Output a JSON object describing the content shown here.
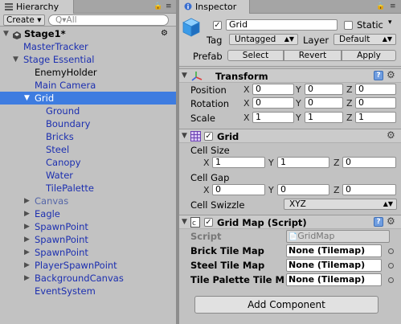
{
  "hierarchy": {
    "tab_label": "Hierarchy",
    "create_label": "Create",
    "search_placeholder": "Q▾All",
    "scene_name": "Stage1*",
    "items": [
      {
        "label": "MasterTracker",
        "color": "blue"
      },
      {
        "label": "Stage Essential",
        "color": "blue",
        "expanded": true
      },
      {
        "label": "EnemyHolder",
        "color": "black"
      },
      {
        "label": "Main Camera",
        "color": "blue"
      },
      {
        "label": "Grid",
        "color": "white",
        "selected": true,
        "expanded": true
      },
      {
        "label": "Ground",
        "color": "blue"
      },
      {
        "label": "Boundary",
        "color": "blue"
      },
      {
        "label": "Bricks",
        "color": "blue"
      },
      {
        "label": "Steel",
        "color": "blue"
      },
      {
        "label": "Canopy",
        "color": "blue"
      },
      {
        "label": "Water",
        "color": "blue"
      },
      {
        "label": "TilePalette",
        "color": "blue"
      },
      {
        "label": "Canvas",
        "color": "grey",
        "collapsed": true
      },
      {
        "label": "Eagle",
        "color": "blue",
        "collapsed": true
      },
      {
        "label": "SpawnPoint",
        "color": "blue",
        "collapsed": true
      },
      {
        "label": "SpawnPoint",
        "color": "blue",
        "collapsed": true
      },
      {
        "label": "SpawnPoint",
        "color": "blue",
        "collapsed": true
      },
      {
        "label": "PlayerSpawnPoint",
        "color": "blue",
        "collapsed": true
      },
      {
        "label": "BackgroundCanvas",
        "color": "blue",
        "collapsed": true
      },
      {
        "label": "EventSystem",
        "color": "blue"
      }
    ]
  },
  "inspector": {
    "tab_label": "Inspector",
    "object_name": "Grid",
    "static_label": "Static",
    "tag_label": "Tag",
    "tag_value": "Untagged",
    "layer_label": "Layer",
    "layer_value": "Default",
    "prefab_label": "Prefab",
    "prefab_select": "Select",
    "prefab_revert": "Revert",
    "prefab_apply": "Apply",
    "transform": {
      "title": "Transform",
      "position_label": "Position",
      "rotation_label": "Rotation",
      "scale_label": "Scale",
      "position": {
        "x": "0",
        "y": "0",
        "z": "0"
      },
      "rotation": {
        "x": "0",
        "y": "0",
        "z": "0"
      },
      "scale": {
        "x": "1",
        "y": "1",
        "z": "1"
      }
    },
    "grid": {
      "title": "Grid",
      "cell_size_label": "Cell Size",
      "cell_size": {
        "x": "1",
        "y": "1",
        "z": "0"
      },
      "cell_gap_label": "Cell Gap",
      "cell_gap": {
        "x": "0",
        "y": "0",
        "z": "0"
      },
      "swizzle_label": "Cell Swizzle",
      "swizzle_value": "XYZ"
    },
    "gridmap": {
      "title": "Grid Map (Script)",
      "script_label": "Script",
      "script_value": "GridMap",
      "brick_label": "Brick Tile Map",
      "brick_value": "None (Tilemap)",
      "steel_label": "Steel Tile Map",
      "steel_value": "None (Tilemap)",
      "palette_label": "Tile Palette Tile M",
      "palette_value": "None (Tilemap)"
    },
    "add_component": "Add Component",
    "axis_x": "X",
    "axis_y": "Y",
    "axis_z": "Z"
  },
  "colors": {
    "selection": "#3e7ce0",
    "object_blue": "#1c2fb0",
    "panel_bg": "#c2c2c2"
  }
}
